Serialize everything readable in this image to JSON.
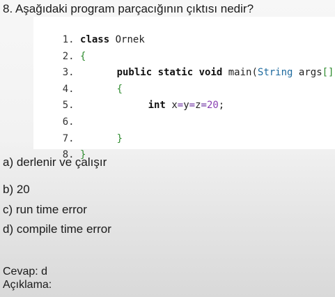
{
  "question": "8. Aşağıdaki program parçacığının çıktısı nedir?",
  "code": {
    "line1": {
      "num": "1.",
      "kw": "class",
      "name": "Ornek"
    },
    "line2": {
      "num": "2.",
      "brace": "{"
    },
    "line3": {
      "num": "3.",
      "kw": "public static void",
      "method": "main(",
      "type": "String",
      "args": "args",
      "brackets": "[])"
    },
    "line4": {
      "num": "4.",
      "brace": "{"
    },
    "line5": {
      "num": "5.",
      "kw": "int",
      "x": "x",
      "eq1": "=",
      "y": "y",
      "eq2": "=",
      "z": "z",
      "eq3": "=",
      "value": "20",
      "semi": ";"
    },
    "line6": {
      "num": "6."
    },
    "line7": {
      "num": "7.",
      "brace": "}"
    },
    "line8": {
      "num": "8.",
      "brace": "}"
    }
  },
  "options": {
    "a": "a) derlenir ve çalışır",
    "b": "b) 20",
    "c": "c) run time error",
    "d": "d) compile time error"
  },
  "answer": "Cevap: d",
  "explanation": "Açıklama:"
}
